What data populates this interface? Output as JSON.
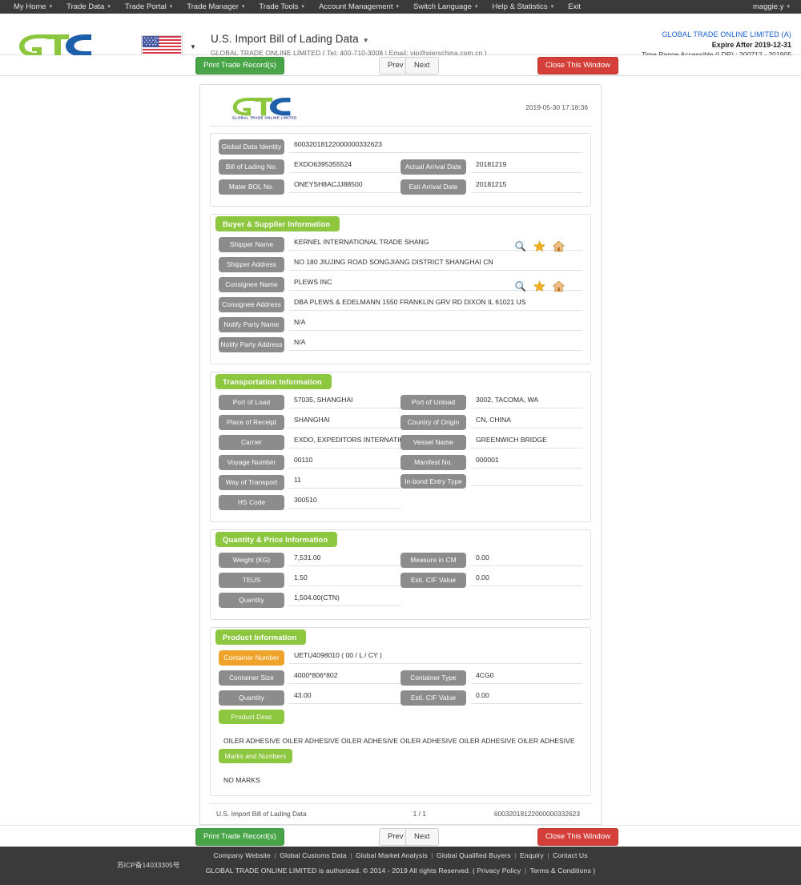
{
  "topbar": {
    "menu": [
      {
        "label": "My Home",
        "caret": true
      },
      {
        "label": "Trade Data",
        "caret": true
      },
      {
        "label": "Trade Portal",
        "caret": true
      },
      {
        "label": "Trade Manager",
        "caret": true
      },
      {
        "label": "Trade Tools",
        "caret": true
      },
      {
        "label": "Account Management",
        "caret": true
      },
      {
        "label": "Switch Language",
        "caret": true
      },
      {
        "label": "Help & Statistics",
        "caret": true
      },
      {
        "label": "Exit",
        "caret": false
      }
    ],
    "user": "maggie.y"
  },
  "header": {
    "logo_text": "GLOBAL TRADE ONLINE LIMITED",
    "flag": "us-flag-icon",
    "title": "U.S. Import Bill of Lading Data",
    "subtitle": "GLOBAL TRADE ONLINE LIMITED ( Tel: 400-710-3008 | Email: vip@pierschina.com.cn )",
    "company": "GLOBAL TRADE ONLINE LIMITED (A)",
    "expire": "Expire After 2019-12-31",
    "time_range": "Time Range Accessible (LDR) : 200712 - 201905"
  },
  "toolbar": {
    "print_label": "Print Trade Record(s)",
    "prev_label": "Prev",
    "next_label": "Next",
    "close_label": "Close This Window"
  },
  "document": {
    "logo_text": "GLOBAL TRADE ONLINE LIMITED",
    "date": "2019-05-30 17:18:36",
    "identity": {
      "rows": [
        {
          "label": "Global Data Identity",
          "value": "60032018122000000332623",
          "full": true
        },
        {
          "label": "Bill of Lading No.",
          "value": "EXDO6395355524",
          "label2": "Actual Arrival Date",
          "value2": "20181219"
        },
        {
          "label": "Mater BOL No.",
          "value": "ONEYSH8ACJJ88500",
          "label2": "Esti Arrival Date",
          "value2": "20181215"
        }
      ]
    },
    "buyer_supplier": {
      "title": "Buyer & Supplier Information",
      "rows": [
        {
          "label": "Shipper Name",
          "value": "KERNEL INTERNATIONAL TRADE SHANG",
          "icons": true
        },
        {
          "label": "Shipper Address",
          "value": "NO 180 JIUJING ROAD SONGJIANG DISTRICT SHANGHAI CN"
        },
        {
          "label": "Consignee Name",
          "value": "PLEWS INC",
          "icons": true
        },
        {
          "label": "Consignee Address",
          "value": "DBA PLEWS & EDELMANN 1550 FRANKLIN GRV RD DIXON IL 61021 US"
        },
        {
          "label": "Notify Party Name",
          "value": "N/A"
        },
        {
          "label": "Notify Party Address",
          "value": "N/A"
        }
      ]
    },
    "transportation": {
      "title": "Transportation Information",
      "rows": [
        {
          "label": "Port of Load",
          "value": "57035, SHANGHAI",
          "label2": "Port of Unload",
          "value2": "3002, TACOMA, WA"
        },
        {
          "label": "Place of Receipt",
          "value": "SHANGHAI",
          "label2": "Country of Origin",
          "value2": "CN, CHINA"
        },
        {
          "label": "Carrier",
          "value": "EXDO, EXPEDITORS INTERNATIONAL",
          "label2": "Vessel Name",
          "value2": "GREENWICH BRIDGE"
        },
        {
          "label": "Voyage Number",
          "value": "00110",
          "label2": "Manifest No.",
          "value2": "000001"
        },
        {
          "label": "Way of Transport",
          "value": "11",
          "label2": "In-bond Entry Type",
          "value2": ""
        },
        {
          "label": "HS Code",
          "value": "300510"
        }
      ]
    },
    "quantity_price": {
      "title": "Quantity & Price Information",
      "rows": [
        {
          "label": "Weight (KG)",
          "value": "7,531.00",
          "label2": "Measure in CM",
          "value2": "0.00"
        },
        {
          "label": "TEUS",
          "value": "1.50",
          "label2": "Esti. CIF Value",
          "value2": "0.00"
        },
        {
          "label": "Quantity",
          "value": "1,504.00(CTN)"
        }
      ]
    },
    "product": {
      "title": "Product Information",
      "container_number_label": "Container Number",
      "container_number_value": "UETU4098010 ( 00 / L / CY )",
      "rows": [
        {
          "label": "Container Size",
          "value": "4000*806*802",
          "label2": "Container Type",
          "value2": "4CG0"
        },
        {
          "label": "Quantity",
          "value": "43.00",
          "label2": "Esti. CIF Value",
          "value2": "0.00"
        }
      ],
      "product_desc_label": "Product Desc",
      "product_desc_value": "OILER ADHESIVE OILER ADHESIVE OILER ADHESIVE OILER ADHESIVE OILER ADHESIVE OILER ADHESIVE",
      "marks_label": "Marks and Numbers",
      "marks_value": "NO MARKS"
    },
    "footer": {
      "left": "U.S. Import Bill of Lading Data",
      "page": "1 / 1",
      "right": "60032018122000000332623"
    }
  },
  "footer": {
    "icp": "苏ICP备14033305号",
    "links": [
      "Company Website",
      "Global Customs Data",
      "Global Market Analysis",
      "Global Qualified Buyers",
      "Enquiry",
      "Contact Us"
    ],
    "copyright": "GLOBAL TRADE ONLINE LIMITED is authorized. © 2014 - 2019 All rights Reserved.",
    "legal": [
      "Privacy Policy",
      "Terms & Conditions"
    ]
  },
  "colors": {
    "accent_green": "#8dc63f",
    "label_gray": "#8c8c8c",
    "orange": "#f0a32b",
    "danger_red": "#d43f3a",
    "success_green": "#47a447",
    "link_blue": "#1a5fd0",
    "dark_bar": "#3a3a3a"
  }
}
